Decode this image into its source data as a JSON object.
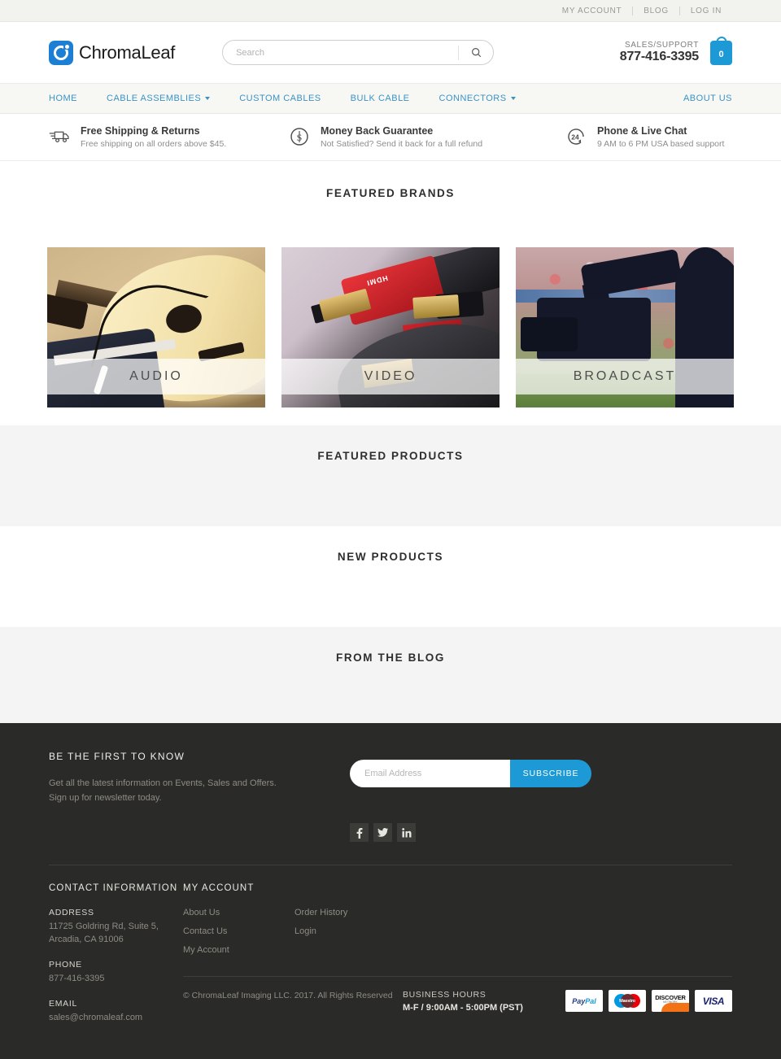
{
  "topbar": {
    "links": [
      {
        "label": "MY ACCOUNT"
      },
      {
        "label": "BLOG"
      },
      {
        "label": "LOG IN"
      }
    ]
  },
  "header": {
    "logo_text": "ChromaLeaf",
    "search": {
      "placeholder": "Search",
      "value": ""
    },
    "support_label": "SALES/SUPPORT",
    "support_phone": "877-416-3395",
    "cart_count": "0"
  },
  "mainnav": {
    "items": [
      {
        "label": "HOME",
        "has_caret": false
      },
      {
        "label": "CABLE ASSEMBLIES",
        "has_caret": true
      },
      {
        "label": "CUSTOM CABLES",
        "has_caret": false
      },
      {
        "label": "BULK CABLE",
        "has_caret": false
      },
      {
        "label": "CONNECTORS",
        "has_caret": true
      }
    ],
    "right_item": {
      "label": "ABOUT US"
    }
  },
  "benefits": [
    {
      "icon": "truck-icon",
      "title": "Free Shipping & Returns",
      "subtitle": "Free shipping on all orders above $45."
    },
    {
      "icon": "dollar-circle-icon",
      "title": "Money Back Guarantee",
      "subtitle": "Not Satisfied? Send it back for a full refund"
    },
    {
      "icon": "24-hour-support-icon",
      "title": "Phone & Live Chat",
      "subtitle": "9 AM to 6 PM USA based support"
    }
  ],
  "sections": {
    "featured_brands_title": "FEATURED BRANDS",
    "featured_products_title": "FEATURED PRODUCTS",
    "new_products_title": "NEW PRODUCTS",
    "from_the_blog_title": "FROM THE BLOG"
  },
  "brands": [
    {
      "label": "AUDIO"
    },
    {
      "label": "VIDEO"
    },
    {
      "label": "BROADCAST"
    }
  ],
  "newsletter": {
    "heading": "BE THE FIRST TO KNOW",
    "line1": "Get all the latest information on Events, Sales and Offers.",
    "line2": "Sign up for newsletter today.",
    "placeholder": "Email Address",
    "value": "",
    "button": "SUBSCRIBE"
  },
  "socials": [
    {
      "name": "facebook-icon",
      "glyph": "f"
    },
    {
      "name": "twitter-icon",
      "glyph": "ᴠ"
    },
    {
      "name": "linkedin-icon",
      "glyph": "in"
    }
  ],
  "footer": {
    "contact_heading": "CONTACT INFORMATION",
    "address_label": "ADDRESS",
    "address_value": "11725 Goldring Rd, Suite 5, Arcadia, CA 91006",
    "phone_label": "PHONE",
    "phone_value": "877-416-3395",
    "email_label": "EMAIL",
    "email_value": "sales@chromaleaf.com",
    "account_heading": "MY ACCOUNT",
    "links_col1": [
      {
        "label": "About Us"
      },
      {
        "label": "Contact Us"
      },
      {
        "label": "My Account"
      }
    ],
    "links_col2": [
      {
        "label": "Order History"
      },
      {
        "label": "Login"
      }
    ],
    "copyright": "© ChromaLeaf Imaging LLC. 2017. All Rights Reserved",
    "hours_label": "BUSINESS HOURS",
    "hours_value": "M-F / 9:00AM - 5:00PM (PST)",
    "payments": [
      {
        "name": "paypal-icon",
        "label": "PayPal"
      },
      {
        "name": "maestro-icon",
        "label": "Maestro"
      },
      {
        "name": "discover-icon",
        "label": "DISCOVER",
        "sub": "NETWORK"
      },
      {
        "name": "visa-icon",
        "label": "VISA"
      }
    ]
  },
  "colors": {
    "brand_blue": "#1d7fd4",
    "accent_blue": "#1d9ad6",
    "nav_blue": "#3a93c4",
    "footer_bg": "#2a2a28"
  }
}
